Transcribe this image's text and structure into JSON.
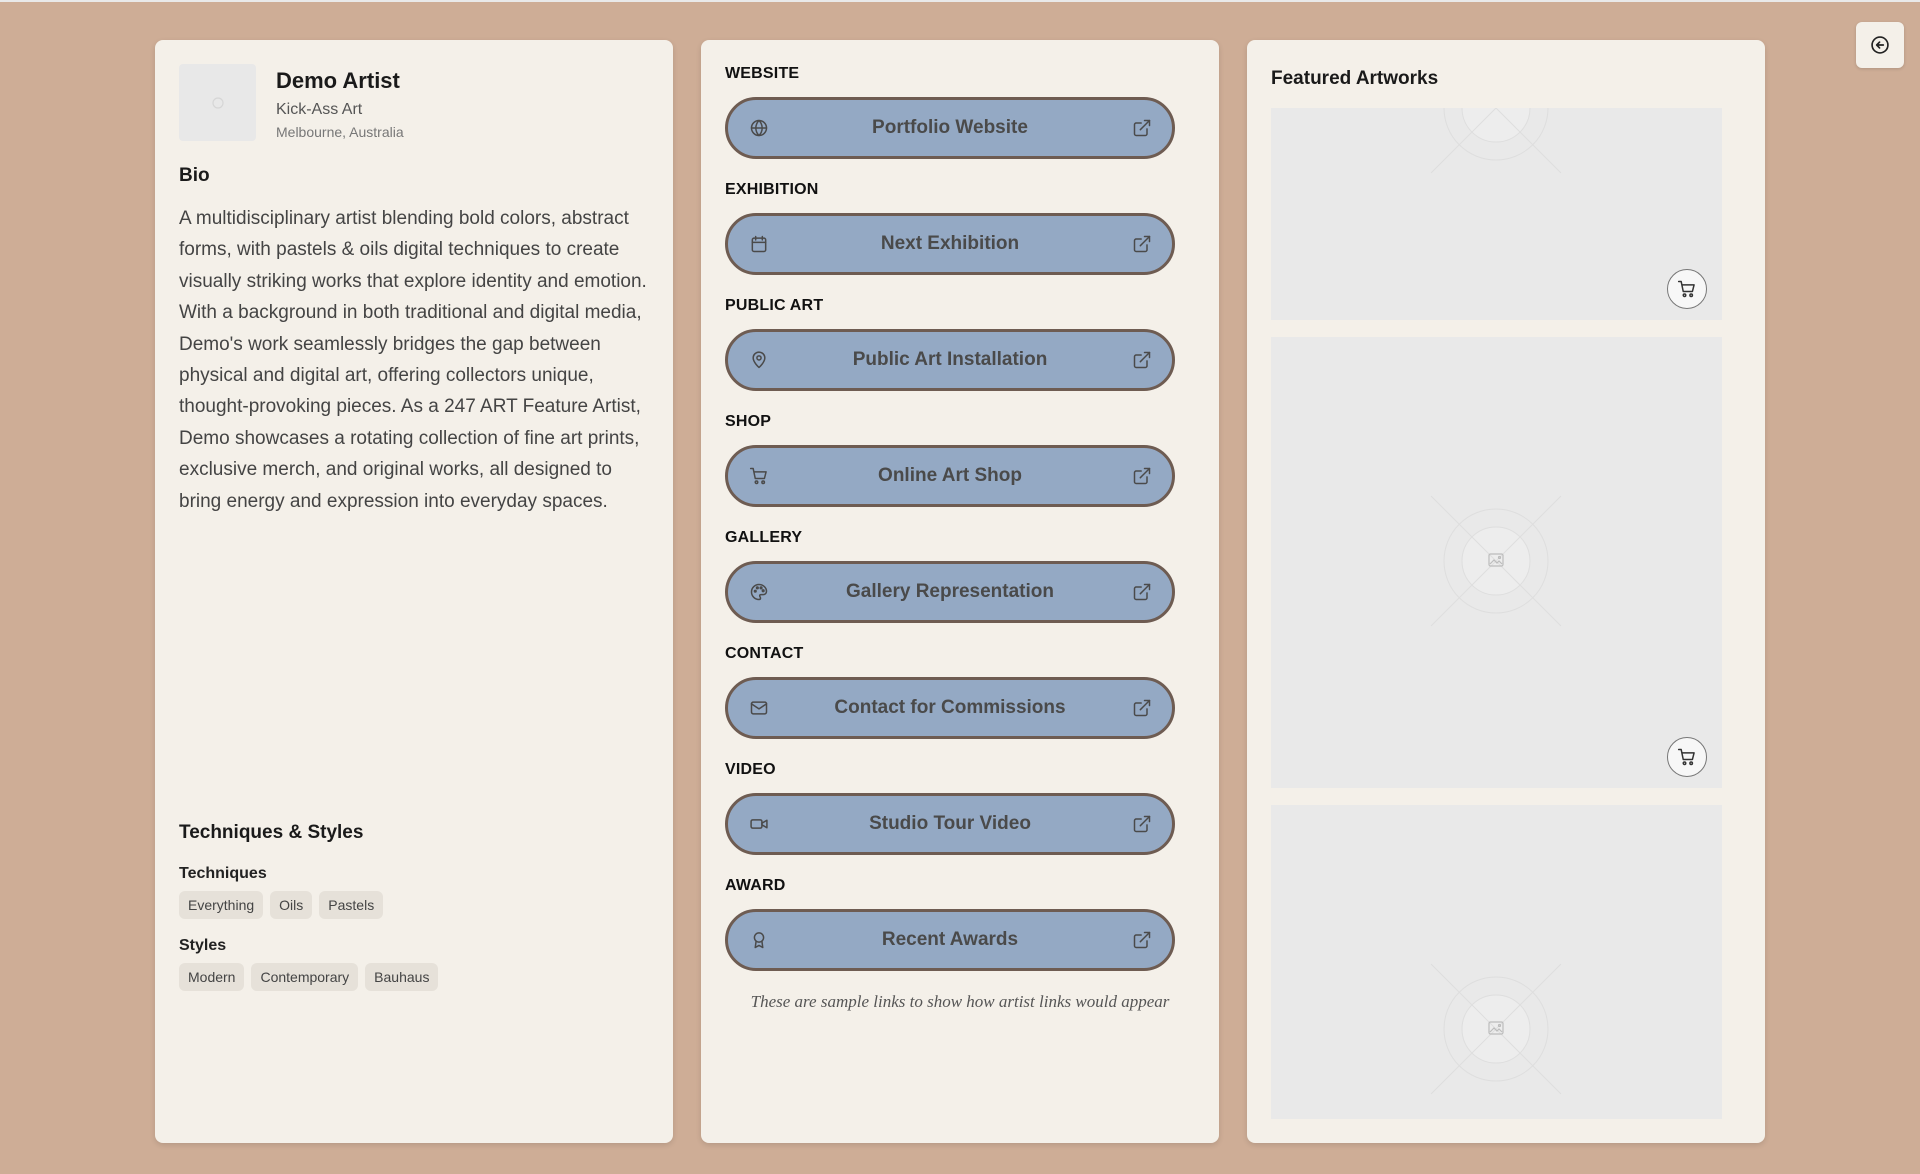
{
  "artist": {
    "name": "Demo Artist",
    "company": "Kick-Ass Art",
    "location": "Melbourne, Australia"
  },
  "bio": {
    "heading": "Bio",
    "text": "A multidisciplinary artist blending bold colors, abstract forms, with pastels & oils digital techniques to create visually striking works that explore identity and emotion. With a background in both traditional and digital media, Demo's work seamlessly bridges the gap between physical and digital art, offering collectors unique, thought-provoking pieces. As a 247 ART Feature Artist, Demo showcases a rotating collection of fine art prints, exclusive merch, and original works, all designed to bring energy and expression into everyday spaces."
  },
  "techniques_styles": {
    "heading": "Techniques & Styles",
    "techniques_label": "Techniques",
    "techniques": [
      "Everything",
      "Oils",
      "Pastels"
    ],
    "styles_label": "Styles",
    "styles": [
      "Modern",
      "Contemporary",
      "Bauhaus"
    ]
  },
  "links": [
    {
      "section": "WEBSITE",
      "label": "Portfolio Website",
      "icon": "globe-icon"
    },
    {
      "section": "EXHIBITION",
      "label": "Next Exhibition",
      "icon": "calendar-icon"
    },
    {
      "section": "PUBLIC ART",
      "label": "Public Art Installation",
      "icon": "map-pin-icon"
    },
    {
      "section": "SHOP",
      "label": "Online Art Shop",
      "icon": "cart-icon"
    },
    {
      "section": "GALLERY",
      "label": "Gallery Representation",
      "icon": "palette-icon"
    },
    {
      "section": "CONTACT",
      "label": "Contact for Commissions",
      "icon": "mail-icon"
    },
    {
      "section": "VIDEO",
      "label": "Studio Tour Video",
      "icon": "video-icon"
    },
    {
      "section": "AWARD",
      "label": "Recent Awards",
      "icon": "award-icon"
    }
  ],
  "links_note": "These are sample links to show how artist links would appear",
  "featured": {
    "title": "Featured Artworks",
    "cards": [
      {
        "has_cart": true
      },
      {
        "has_cart": true
      },
      {
        "has_cart": false
      }
    ]
  },
  "colors": {
    "background": "#cead96",
    "panel": "#f4f0e9",
    "link_button": "#94a9c4",
    "link_border": "#6e5c52"
  }
}
